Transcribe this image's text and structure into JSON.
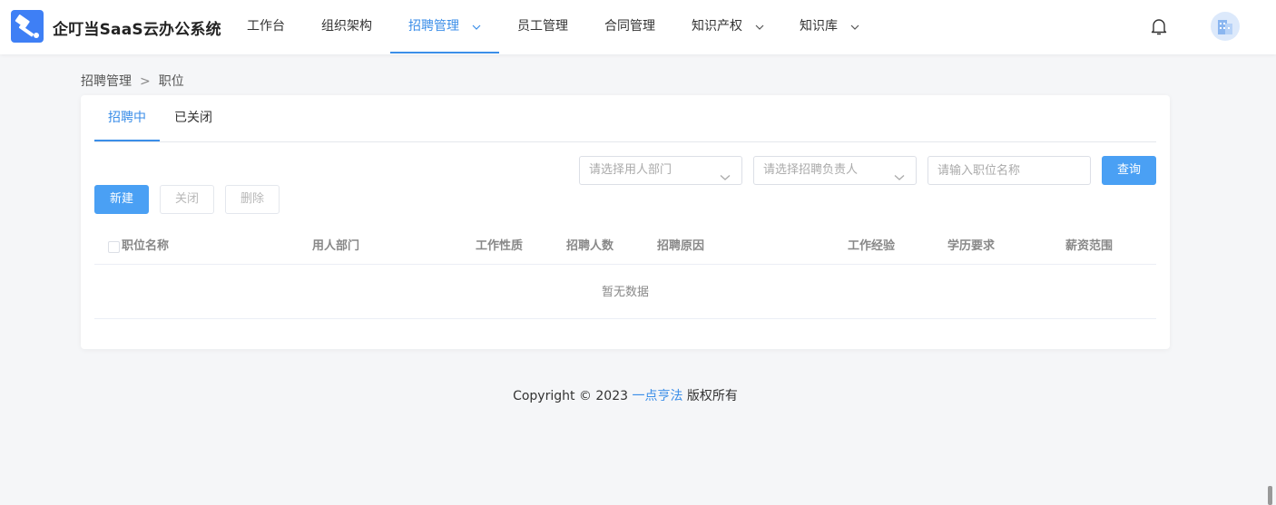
{
  "app": {
    "title": "企叮当SaaS云办公系统"
  },
  "nav": {
    "items": [
      {
        "label": "工作台"
      },
      {
        "label": "组织架构"
      },
      {
        "label": "招聘管理"
      },
      {
        "label": "员工管理"
      },
      {
        "label": "合同管理"
      },
      {
        "label": "知识产权"
      },
      {
        "label": "知识库"
      }
    ]
  },
  "breadcrumb": {
    "parent": "招聘管理",
    "separator": ">",
    "current": "职位"
  },
  "tabs": [
    {
      "label": "招聘中"
    },
    {
      "label": "已关闭"
    }
  ],
  "filters": {
    "department_placeholder": "请选择用人部门",
    "owner_placeholder": "请选择招聘负责人",
    "position_placeholder": "请输入职位名称",
    "query_label": "查询"
  },
  "actions": {
    "new_label": "新建",
    "close_label": "关闭",
    "delete_label": "删除"
  },
  "table": {
    "columns": [
      "职位名称",
      "用人部门",
      "工作性质",
      "招聘人数",
      "招聘原因",
      "工作经验",
      "学历要求",
      "薪资范围"
    ],
    "empty_text": "暂无数据"
  },
  "footer": {
    "prefix": "Copyright © 2023 ",
    "link": "一点亨法",
    "suffix": " 版权所有"
  },
  "colors": {
    "accent": "#3b8ee8",
    "primary_button": "#4aa0f4",
    "logo": "#3e7ff5"
  },
  "icons": {
    "logo": "hammer-logo-icon",
    "notification": "bell-icon",
    "avatar": "building-avatar-icon",
    "dropdown": "chevron-down-icon"
  }
}
